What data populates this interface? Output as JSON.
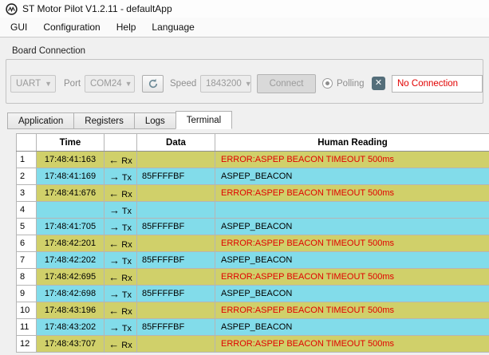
{
  "window": {
    "title": "ST Motor Pilot V1.2.11 - defaultApp",
    "app_icon": "st-motor-pilot-logo"
  },
  "menu": {
    "items": [
      "GUI",
      "Configuration",
      "Help",
      "Language"
    ]
  },
  "board_connection": {
    "group_label": "Board Connection",
    "interface_select": {
      "value": "UART",
      "disabled": true
    },
    "port_label": "Port",
    "port_select": {
      "value": "COM24",
      "disabled": true
    },
    "refresh_icon": "refresh-arrows",
    "speed_label": "Speed",
    "speed_select": {
      "value": "1843200",
      "disabled": true
    },
    "connect_button": "Connect",
    "polling_label": "Polling",
    "clear_icon": "close-x",
    "connection_status": "No Connection"
  },
  "tabs": [
    {
      "label": "Application",
      "active": false
    },
    {
      "label": "Registers",
      "active": false
    },
    {
      "label": "Logs",
      "active": false
    },
    {
      "label": "Terminal",
      "active": true
    }
  ],
  "terminal_table": {
    "headers": {
      "time": "Time",
      "data": "Data",
      "human_reading": "Human Reading"
    },
    "rows": [
      {
        "num": "1",
        "time": "17:48:41:163",
        "arrow": "←",
        "dir": "Rx",
        "data": "",
        "human": "ERROR:ASPEP BEACON TIMEOUT 500ms",
        "type": "rx"
      },
      {
        "num": "2",
        "time": "17:48:41:169",
        "arrow": "→",
        "dir": "Tx",
        "data": "85FFFFBF",
        "human": "ASPEP_BEACON",
        "type": "tx"
      },
      {
        "num": "3",
        "time": "17:48:41:676",
        "arrow": "←",
        "dir": "Rx",
        "data": "",
        "human": "ERROR:ASPEP BEACON TIMEOUT 500ms",
        "type": "rx"
      },
      {
        "num": "4",
        "time": "",
        "arrow": "→",
        "dir": "Tx",
        "data": "",
        "human": "",
        "type": "tx"
      },
      {
        "num": "5",
        "time": "17:48:41:705",
        "arrow": "→",
        "dir": "Tx",
        "data": "85FFFFBF",
        "human": "ASPEP_BEACON",
        "type": "tx"
      },
      {
        "num": "6",
        "time": "17:48:42:201",
        "arrow": "←",
        "dir": "Rx",
        "data": "",
        "human": "ERROR:ASPEP BEACON TIMEOUT 500ms",
        "type": "rx"
      },
      {
        "num": "7",
        "time": "17:48:42:202",
        "arrow": "→",
        "dir": "Tx",
        "data": "85FFFFBF",
        "human": "ASPEP_BEACON",
        "type": "tx"
      },
      {
        "num": "8",
        "time": "17:48:42:695",
        "arrow": "←",
        "dir": "Rx",
        "data": "",
        "human": "ERROR:ASPEP BEACON TIMEOUT 500ms",
        "type": "rx"
      },
      {
        "num": "9",
        "time": "17:48:42:698",
        "arrow": "→",
        "dir": "Tx",
        "data": "85FFFFBF",
        "human": "ASPEP_BEACON",
        "type": "tx"
      },
      {
        "num": "10",
        "time": "17:48:43:196",
        "arrow": "←",
        "dir": "Rx",
        "data": "",
        "human": "ERROR:ASPEP BEACON TIMEOUT 500ms",
        "type": "rx"
      },
      {
        "num": "11",
        "time": "17:48:43:202",
        "arrow": "→",
        "dir": "Tx",
        "data": "85FFFFBF",
        "human": "ASPEP_BEACON",
        "type": "tx"
      },
      {
        "num": "12",
        "time": "17:48:43:707",
        "arrow": "←",
        "dir": "Rx",
        "data": "",
        "human": "ERROR:ASPEP BEACON TIMEOUT 500ms",
        "type": "rx"
      }
    ]
  },
  "colors": {
    "rx_row_bg": "#d0d06a",
    "tx_row_bg": "#82dcea",
    "error_text": "#e10000",
    "status_text": "#e10000"
  }
}
